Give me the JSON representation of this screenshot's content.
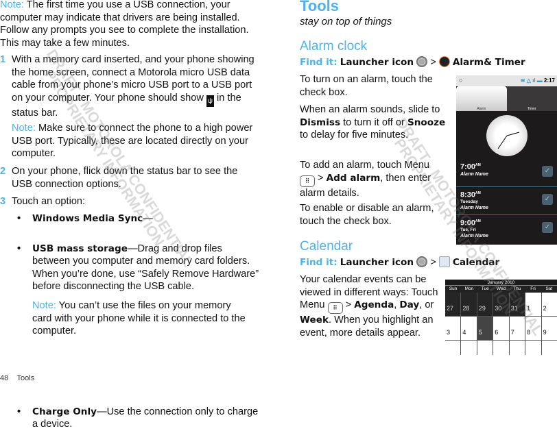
{
  "left": {
    "note1_label": "Note:",
    "note1_text": " The first time you use a USB connection, your computer may indicate that drivers are being installed. Follow any prompts you see to complete the installation. This may take a few minutes.",
    "steps": [
      {
        "num": "1",
        "text_a": "With a memory card inserted, and your phone showing the home screen, connect a Motorola micro USB data cable from your phone’s micro USB port to a USB port on your computer. Your phone should show ",
        "icon": "usb-icon",
        "text_b": " in the status bar."
      },
      {
        "num": "2",
        "text": "On your phone, flick down the status bar to see the USB connection options."
      },
      {
        "num": "3",
        "text": "Touch an option:"
      }
    ],
    "note2_label": "Note:",
    "note2_text": " Make sure to connect the phone to a high power USB port. Typically, these are located directly on your computer.",
    "options": [
      {
        "title": "Windows Media Sync",
        "text": "—"
      },
      {
        "title": "USB mass storage",
        "text": "—Drag and drop files between you computer and memory card folders. When you’re done, use “Safely Remove Hardware” before disconnecting the USB cable."
      },
      {
        "title": "Charge Only",
        "text": "—Use the connection only to charge a device."
      }
    ],
    "note3_label": "Note:",
    "note3_text": "  You can’t use the files on your memory card with your phone while it is connected to the computer."
  },
  "right": {
    "title": "Tools",
    "subtitle": "stay on top of things",
    "alarm": {
      "heading": "Alarm clock",
      "findit": "Find it:",
      "launcher": "Launcher icon",
      "sep": ">",
      "target": "Alarm& Timer",
      "p1": "To turn on an alarm, touch the check box.",
      "p2a": "When an alarm sounds, slide to ",
      "dismiss": "Dismiss",
      "p2b": " to turn it off or ",
      "snooze": "Snooze",
      "p2c": " to delay for five minutes.",
      "p3a": "To add an alarm, touch Menu ",
      "p3b": " > ",
      "add": "Add alarm",
      "p3c": ", then enter alarm details.",
      "p4": "To enable or disable an alarm, touch the check box."
    },
    "calendar": {
      "heading": "Calendar",
      "findit": "Find it:",
      "launcher": "Launcher icon",
      "sep": ">",
      "target": "Calendar",
      "pa": "Your calendar events can be viewed in different ways: Touch Menu ",
      "pb": " > ",
      "agenda": "Agenda",
      "pc": ", ",
      "day": "Day",
      "pd": ", or ",
      "week": "Week",
      "pe": ". When you highlight an event, more details appear."
    }
  },
  "phone_alarm": {
    "time": "2:17",
    "tab_alarm": "Alarm",
    "tab_timer": "Timer",
    "alarms": [
      {
        "time": "7:00",
        "ampm": "AM",
        "days": "",
        "name": "Alarm Name",
        "enabled": true
      },
      {
        "time": "8:30",
        "ampm": "AM",
        "days": "Tuesday",
        "name": "Alarm Name",
        "enabled": true
      },
      {
        "time": "9:00",
        "ampm": "AM",
        "days": "Tue, Fri",
        "name": "Alarm Name",
        "enabled": true
      }
    ]
  },
  "phone_calendar": {
    "month": "January 2010",
    "weekdays": [
      "Sun",
      "Mon",
      "Tue",
      "Wed",
      "Thu",
      "Fri",
      "Sat"
    ],
    "days": [
      "27",
      "28",
      "29",
      "30",
      "31",
      "1",
      "2",
      "3",
      "4",
      "5",
      "6",
      "7",
      "8",
      "9"
    ],
    "selected": "5"
  },
  "footer": {
    "page": "48",
    "section": "Tools"
  },
  "watermark": [
    "DRAFT - MOTOROLA CONFIDENTIAL",
    "PROPRIETARY INFORMATION"
  ],
  "colors": {
    "accent": "#4fb3e6"
  }
}
